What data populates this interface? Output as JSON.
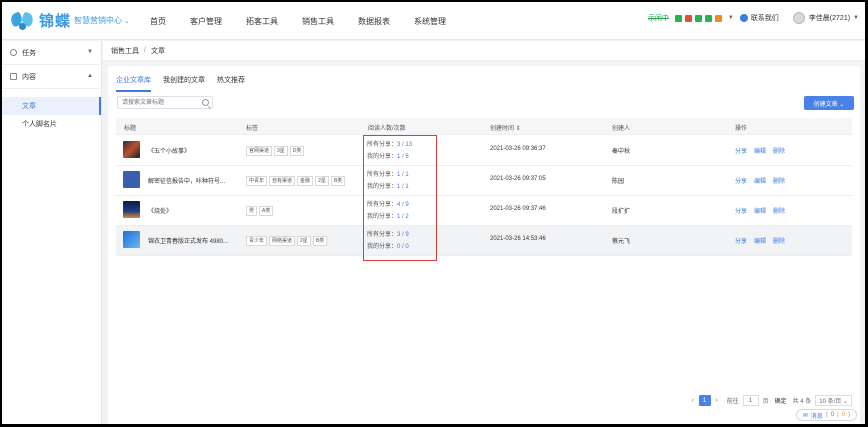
{
  "brand": {
    "name": "锦蝶",
    "sub": "智慧营销中心",
    "caret": "⌄"
  },
  "nav": [
    "首页",
    "客户管理",
    "拓客工具",
    "销售工具",
    "数据报表",
    "系统管理"
  ],
  "topright": {
    "opportunity": "示闲中",
    "contact": "联系我们",
    "user": "李佳晨(2721)"
  },
  "sidebar": {
    "groups": [
      {
        "label": "任务",
        "items": []
      },
      {
        "label": "内容",
        "items": [
          {
            "label": "文章",
            "active": true
          },
          {
            "label": "个人脚名片",
            "active": false
          }
        ]
      }
    ]
  },
  "breadcrumb": [
    "销售工具",
    "文章"
  ],
  "tabs": [
    "企业文章库",
    "我创建的文章",
    "热文推荐"
  ],
  "search": {
    "placeholder": "请搜索文章标题"
  },
  "create_button": "创建文章 ⌄",
  "table": {
    "headers": [
      "标题",
      "标签",
      "阅读人数/次数",
      "创建时间 ⇕",
      "创建人",
      "操作"
    ],
    "rows": [
      {
        "title": "《五个小故事》",
        "tags": [
          "官网渠道",
          "3星",
          "D类"
        ],
        "reads_all_label": "所有分享：",
        "reads_all": "3 / 13",
        "reads_mine_label": "我的分享：",
        "reads_mine": "1 / 6",
        "time": "2021-03-26 09:36:37",
        "creator": "秦中秋"
      },
      {
        "title": "解密征信报告中，咔种符号...",
        "tags": [
          "中青年",
          "自有渠道",
          "金融",
          "2星",
          "B类"
        ],
        "reads_all_label": "所有分享：",
        "reads_all": "1 / 1",
        "reads_mine_label": "我的分享：",
        "reads_mine": "1 / 1",
        "time": "2021-03-26 09:37:05",
        "creator": "陈园"
      },
      {
        "title": "《烧处》",
        "tags": [
          "男",
          "A类"
        ],
        "reads_all_label": "所有分享：",
        "reads_all": "4 / 9",
        "reads_mine_label": "我的分享：",
        "reads_mine": "1 / 2",
        "time": "2021-03-26 09:37:46",
        "creator": "段扩扩"
      },
      {
        "title": "锦衣卫青春版正式发布 4980...",
        "tags": [
          "青少年",
          "网络渠道",
          "2星",
          "B类"
        ],
        "reads_all_label": "所有分享：",
        "reads_all": "3 / 9",
        "reads_mine_label": "我的分享：",
        "reads_mine": "0 / 0",
        "time": "2021-03-26 14:53:46",
        "creator": "蔡元飞"
      }
    ],
    "ops": [
      "分享",
      "编辑",
      "删除"
    ]
  },
  "pagination": {
    "prev": "‹",
    "page": "1",
    "next": "›",
    "goto": "前往",
    "goto_value": "1",
    "unit": "页",
    "confirm": "确定",
    "total": "共 4 条",
    "size": "10 条/页 ⌄"
  },
  "message": {
    "label": "消息",
    "count_a": "0",
    "count_b": "0"
  },
  "colors": {
    "accent": "#3d7bdf",
    "highlight_box": "#e03a3a"
  }
}
